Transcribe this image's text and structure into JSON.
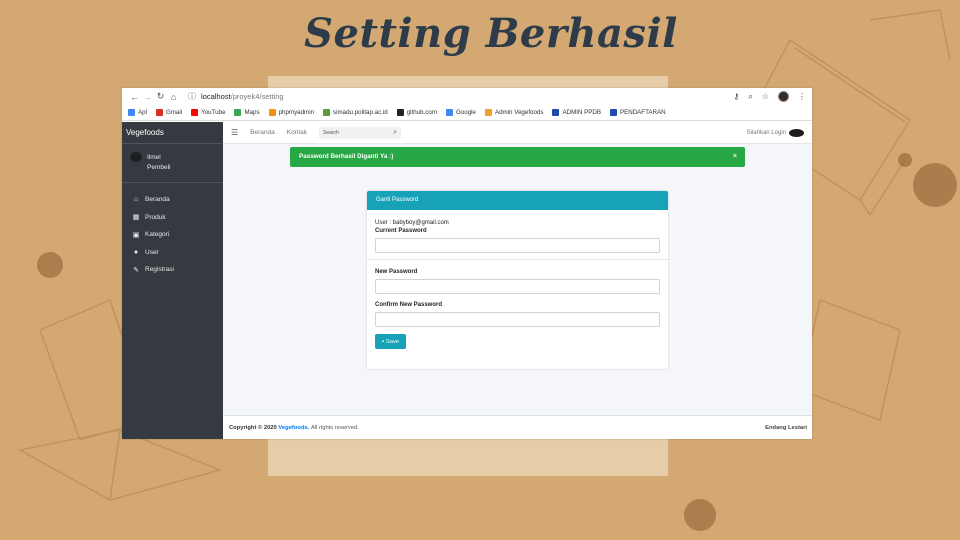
{
  "slide": {
    "title": "Setting Berhasil"
  },
  "browser": {
    "url_host": "localhost",
    "url_path": "/proyek4/setting",
    "bookmarks": [
      {
        "label": "Apl",
        "icon": "apps-grid-icon",
        "color": "#4285f4"
      },
      {
        "label": "Gmail",
        "icon": "gmail-icon",
        "color": "#d93025"
      },
      {
        "label": "YouTube",
        "icon": "youtube-icon",
        "color": "#ff0000"
      },
      {
        "label": "Maps",
        "icon": "maps-pin-icon",
        "color": "#34a853"
      },
      {
        "label": "phpmyadmin",
        "icon": "phpmyadmin-icon",
        "color": "#f29111"
      },
      {
        "label": "simadu.politap.ac.id",
        "icon": "simadu-icon",
        "color": "#5a9a3c"
      },
      {
        "label": "github.com",
        "icon": "github-icon",
        "color": "#222222"
      },
      {
        "label": "Google",
        "icon": "google-icon",
        "color": "#4285f4"
      },
      {
        "label": "Admin Vegefoods",
        "icon": "vegefoods-icon",
        "color": "#f0a030"
      },
      {
        "label": "ADMIN PPDB",
        "icon": "ppdb-icon",
        "color": "#1e4aa8"
      },
      {
        "label": "PENDAFTARAN",
        "icon": "pendaftaran-icon",
        "color": "#1e4aa8"
      }
    ]
  },
  "sidebar": {
    "brand": "Vegefoods",
    "user_name": "Ilmel",
    "user_role": "Pembeli",
    "items": [
      {
        "label": "Beranda",
        "icon": "home-icon"
      },
      {
        "label": "Produk",
        "icon": "calendar-icon"
      },
      {
        "label": "Kategori",
        "icon": "image-icon"
      },
      {
        "label": "User",
        "icon": "user-icon"
      },
      {
        "label": "Registrasi",
        "icon": "edit-icon"
      }
    ]
  },
  "topnav": {
    "links": [
      "Beranda",
      "Kontak"
    ],
    "search_placeholder": "Search",
    "login_text": "Silahkan Login"
  },
  "alert": {
    "message": "Password Berhasil Diganti Ya :)",
    "close": "×",
    "color": "#28a745"
  },
  "form": {
    "header": "Ganti Password",
    "user_line": "User : babyboy@gmail.com",
    "current_label": "Current Password",
    "new_label": "New Password",
    "confirm_label": "Confirm New Password",
    "save_label": "Save",
    "accent": "#17a2b8"
  },
  "footer": {
    "copyright": "Copyright © 2020",
    "brand": "Vegefoods.",
    "rights": "All rights reserved.",
    "author": "Endang Lestari"
  }
}
